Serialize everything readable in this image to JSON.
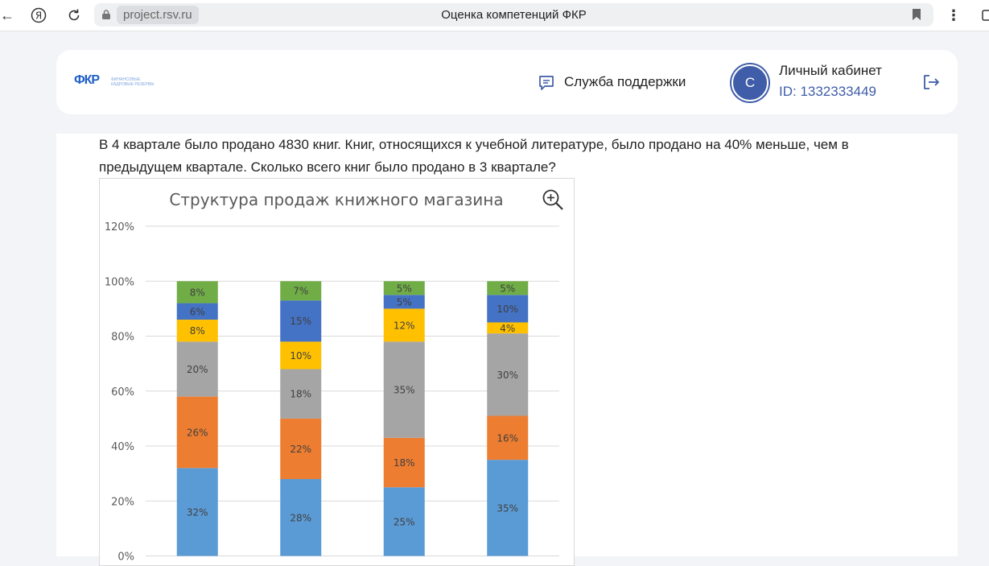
{
  "browser": {
    "url": "project.rsv.ru",
    "title": "Оценка компетенций ФКР"
  },
  "header": {
    "logo_text": "ФКР",
    "logo_sub": "ФИНАНСОВЫЕ КАДРОВЫЕ РЕЗЕРВЫ",
    "support_label": "Служба поддержки",
    "avatar_letter": "С",
    "cabinet_title": "Личный кабинет",
    "cabinet_id": "ID: 1332333449"
  },
  "question": {
    "text": "В 4 квартале было продано 4830 книг. Книг, относящихся к учебной литературе, было продано на 40% меньше, чем в предыдущем квартале. Сколько всего книг было продано в 3 квартале?"
  },
  "colors": {
    "blue_light": "#5b9bd5",
    "orange": "#ed7d31",
    "gray": "#a5a5a5",
    "yellow": "#ffc000",
    "blue_dark": "#4472c4",
    "green": "#70ad47",
    "accent": "#3f5da8"
  },
  "chart_data": {
    "type": "bar",
    "stacked": true,
    "title": "Структура продаж книжного магазина",
    "ylim": [
      0,
      120
    ],
    "yticks": [
      "0%",
      "20%",
      "40%",
      "60%",
      "80%",
      "100%",
      "120%"
    ],
    "grid": true,
    "categories": [
      "",
      "",
      "",
      ""
    ],
    "series": [
      {
        "values": [
          32,
          28,
          25,
          35
        ],
        "color": "#5b9bd5"
      },
      {
        "values": [
          26,
          22,
          18,
          16
        ],
        "color": "#ed7d31"
      },
      {
        "values": [
          20,
          18,
          35,
          30
        ],
        "color": "#a5a5a5"
      },
      {
        "values": [
          8,
          10,
          12,
          4
        ],
        "color": "#ffc000"
      },
      {
        "values": [
          6,
          15,
          5,
          10
        ],
        "color": "#4472c4"
      },
      {
        "values": [
          8,
          7,
          5,
          5
        ],
        "color": "#70ad47"
      }
    ]
  }
}
